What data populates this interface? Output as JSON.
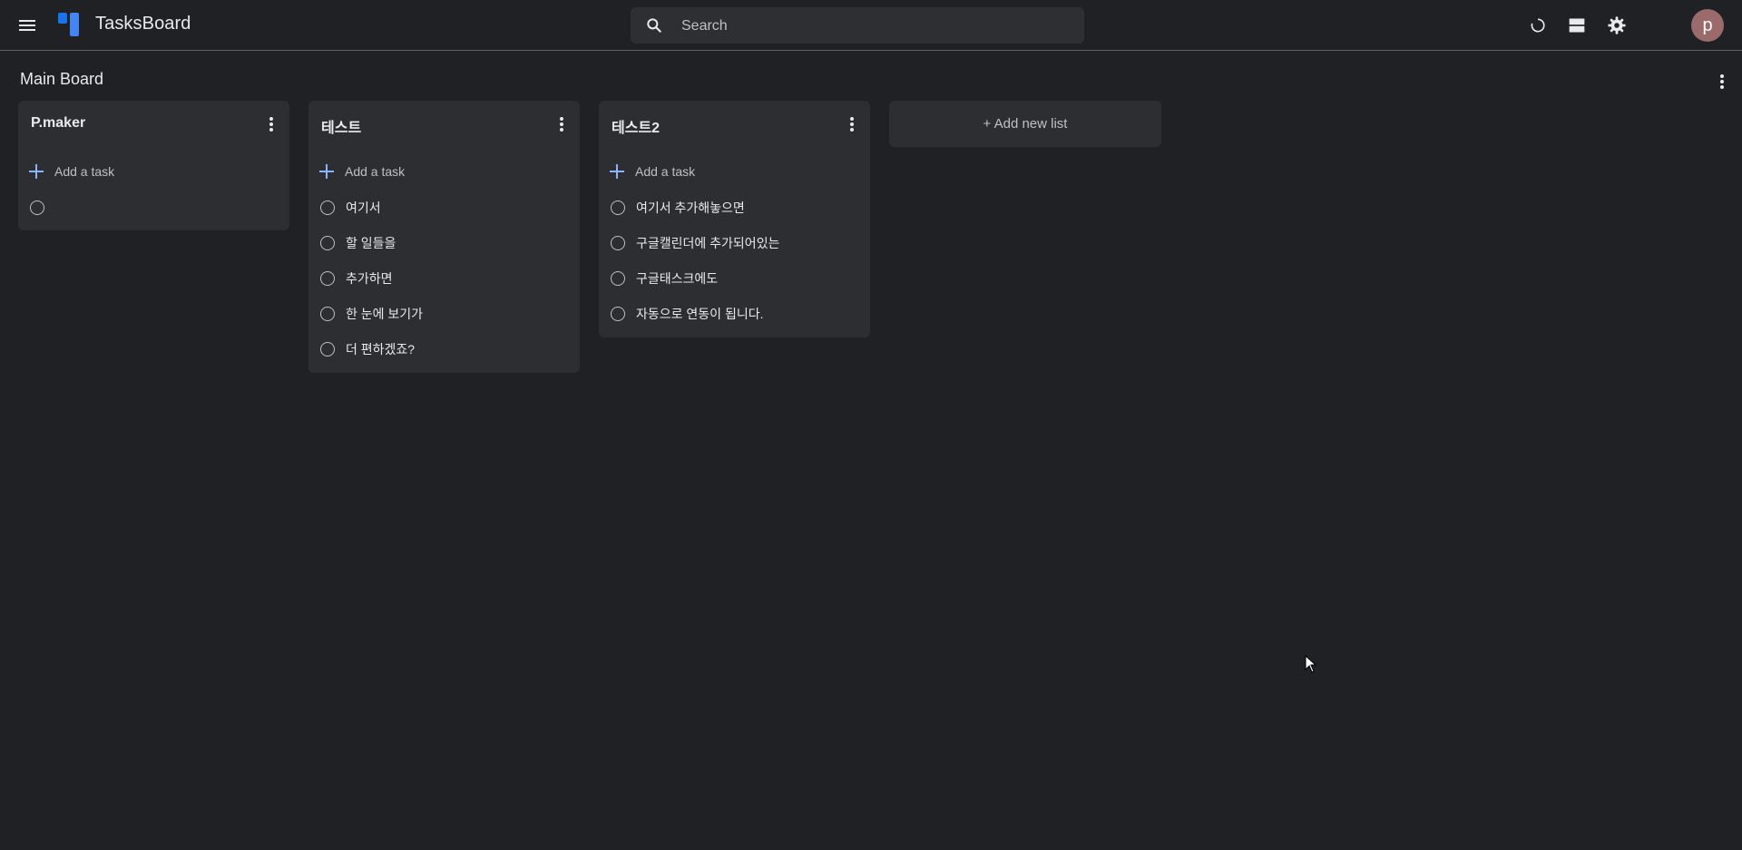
{
  "app": {
    "title": "TasksBoard",
    "search_placeholder": "Search",
    "avatar_letter": "p",
    "accent_color": "#1a73e8",
    "add_color": "#8ab4f8"
  },
  "board": {
    "title": "Main Board",
    "add_list_label": "+ Add new list"
  },
  "lists": [
    {
      "title": "P.maker",
      "add_label": "Add a task",
      "tasks": [
        ""
      ]
    },
    {
      "title": "테스트",
      "add_label": "Add a task",
      "tasks": [
        "여기서",
        "할 일들을",
        "추가하면",
        "한 눈에 보기가",
        "더 편하겠죠?"
      ]
    },
    {
      "title": "테스트2",
      "add_label": "Add a task",
      "tasks": [
        "여기서 추가해놓으면",
        "구글캘린더에 추가되어있는",
        "구글태스크에도",
        "자동으로 연동이 됩니다."
      ]
    }
  ],
  "icons": {
    "menu": "hamburger-icon",
    "search": "search-icon",
    "refresh": "refresh-icon",
    "layout": "layout-icon",
    "settings": "gear-icon",
    "more": "more-vert-icon"
  }
}
